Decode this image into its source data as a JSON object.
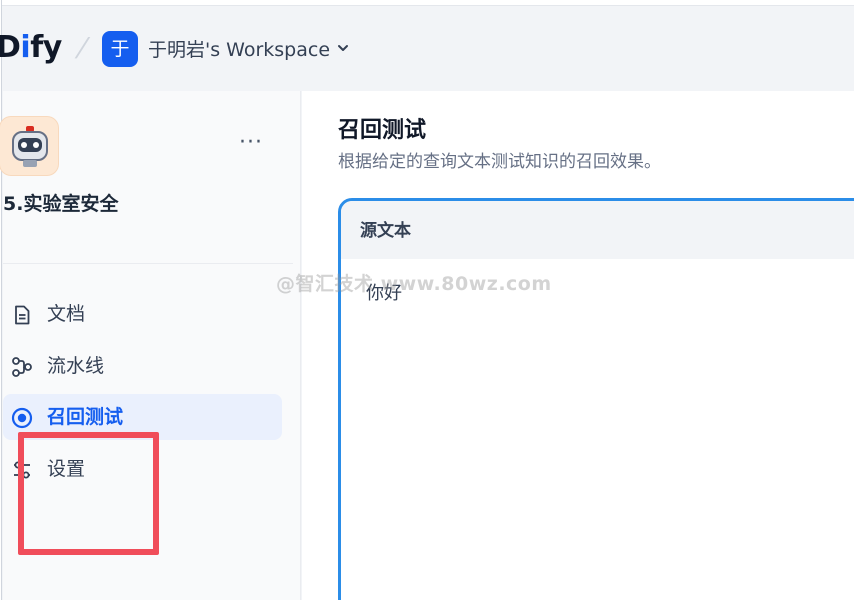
{
  "brand": {
    "logo_pre": "Di",
    "logo_accent": "i",
    "logo_post": "fy"
  },
  "workspace": {
    "avatar_letter": "于",
    "name": "于明岩's Workspace"
  },
  "dataset": {
    "name": "5.实验室安全",
    "more": "···"
  },
  "sidebar": {
    "items": [
      {
        "label": "文档",
        "icon": "document-icon"
      },
      {
        "label": "流水线",
        "icon": "pipeline-icon"
      },
      {
        "label": "召回测试",
        "icon": "target-icon",
        "active": true
      },
      {
        "label": "设置",
        "icon": "settings-icon"
      }
    ]
  },
  "main": {
    "title": "召回测试",
    "description": "根据给定的查询文本测试知识的召回效果。",
    "source_card": {
      "title": "源文本",
      "query": "你好"
    }
  },
  "watermark": "@智汇技术 www.80wz.com",
  "colors": {
    "accent": "#155eef",
    "card_border": "#2b8de8",
    "highlight": "#f04d5a",
    "active_bg": "#eaf0fd"
  }
}
